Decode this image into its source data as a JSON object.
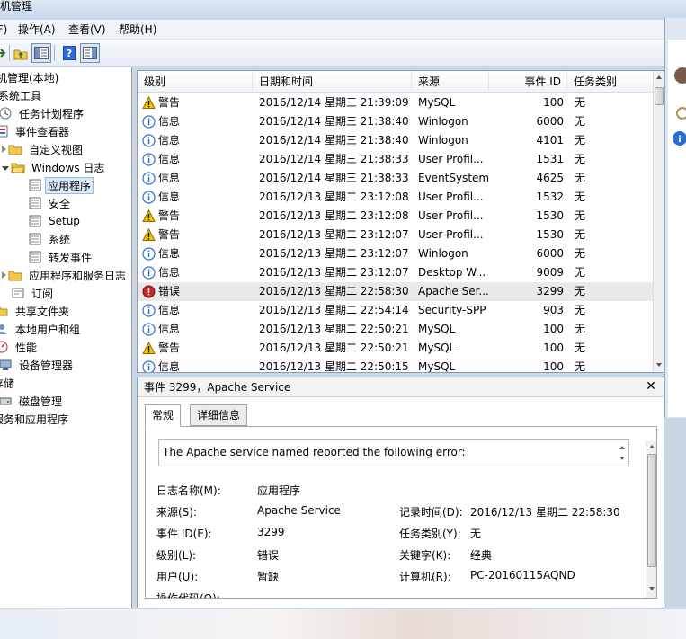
{
  "window": {
    "title": "机管理"
  },
  "menu": [
    {
      "label": "件(F)",
      "x": 0
    },
    {
      "label": "操作(A)"
    },
    {
      "label": "查看(V)"
    },
    {
      "label": "帮助(H)"
    }
  ],
  "tree": {
    "items": [
      {
        "label": "机管理(本地)"
      },
      {
        "label": "系统工具"
      },
      {
        "label": "任务计划程序"
      },
      {
        "label": "事件查看器"
      },
      {
        "label": "自定义视图"
      },
      {
        "label": "Windows 日志"
      },
      {
        "label": "应用程序"
      },
      {
        "label": "安全"
      },
      {
        "label": "Setup"
      },
      {
        "label": "系统"
      },
      {
        "label": "转发事件"
      },
      {
        "label": "应用程序和服务日志"
      },
      {
        "label": "订阅"
      },
      {
        "label": "共享文件夹"
      },
      {
        "label": "本地用户和组"
      },
      {
        "label": "性能"
      },
      {
        "label": "设备管理器"
      },
      {
        "label": "存储"
      },
      {
        "label": "磁盘管理"
      },
      {
        "label": "服务和应用程序"
      }
    ]
  },
  "grid": {
    "columns": [
      "级别",
      "日期和时间",
      "来源",
      "事件 ID",
      "任务类别"
    ],
    "rows": [
      {
        "level": "警告",
        "icon": "warning-icon",
        "datetime": "2016/12/14 星期三 21:39:09",
        "source": "MySQL",
        "id": "100",
        "task": "无"
      },
      {
        "level": "信息",
        "icon": "info-icon",
        "datetime": "2016/12/14 星期三 21:38:40",
        "source": "Winlogon",
        "id": "6000",
        "task": "无"
      },
      {
        "level": "信息",
        "icon": "info-icon",
        "datetime": "2016/12/14 星期三 21:38:40",
        "source": "Winlogon",
        "id": "4101",
        "task": "无"
      },
      {
        "level": "信息",
        "icon": "info-icon",
        "datetime": "2016/12/14 星期三 21:38:33",
        "source": "User Profil...",
        "id": "1531",
        "task": "无"
      },
      {
        "level": "信息",
        "icon": "info-icon",
        "datetime": "2016/12/14 星期三 21:38:33",
        "source": "EventSystem",
        "id": "4625",
        "task": "无"
      },
      {
        "level": "信息",
        "icon": "info-icon",
        "datetime": "2016/12/13 星期二 23:12:08",
        "source": "User Profil...",
        "id": "1532",
        "task": "无"
      },
      {
        "level": "警告",
        "icon": "warning-icon",
        "datetime": "2016/12/13 星期二 23:12:08",
        "source": "User Profil...",
        "id": "1530",
        "task": "无"
      },
      {
        "level": "警告",
        "icon": "warning-icon",
        "datetime": "2016/12/13 星期二 23:12:07",
        "source": "User Profil...",
        "id": "1530",
        "task": "无"
      },
      {
        "level": "信息",
        "icon": "info-icon",
        "datetime": "2016/12/13 星期二 23:12:07",
        "source": "Winlogon",
        "id": "6000",
        "task": "无"
      },
      {
        "level": "信息",
        "icon": "info-icon",
        "datetime": "2016/12/13 星期二 23:12:07",
        "source": "Desktop W...",
        "id": "9009",
        "task": "无"
      },
      {
        "level": "错误",
        "icon": "error-icon",
        "datetime": "2016/12/13 星期二 22:58:30",
        "source": "Apache Ser...",
        "id": "3299",
        "task": "无",
        "selected": true
      },
      {
        "level": "信息",
        "icon": "info-icon",
        "datetime": "2016/12/13 星期二 22:54:14",
        "source": "Security-SPP",
        "id": "903",
        "task": "无"
      },
      {
        "level": "信息",
        "icon": "info-icon",
        "datetime": "2016/12/13 星期二 22:50:21",
        "source": "MySQL",
        "id": "100",
        "task": "无"
      },
      {
        "level": "警告",
        "icon": "warning-icon",
        "datetime": "2016/12/13 星期二 22:50:21",
        "source": "MySQL",
        "id": "100",
        "task": "无"
      },
      {
        "level": "信息",
        "icon": "info-icon",
        "datetime": "2016/12/13 星期二 22:50:15",
        "source": "MySQL",
        "id": "100",
        "task": "无"
      }
    ]
  },
  "detail": {
    "title": "事件 3299，Apache Service",
    "tabs": [
      "常规",
      "详细信息"
    ],
    "message": "The Apache service named  reported the following error:",
    "fields": {
      "log_name_label": "日志名称(M):",
      "log_name": "应用程序",
      "source_label": "来源(S):",
      "source": "Apache Service",
      "logged_label": "记录时间(D):",
      "logged": "2016/12/13 星期二 22:58:30",
      "event_id_label": "事件 ID(E):",
      "event_id": "3299",
      "task_label": "任务类别(Y):",
      "task": "无",
      "level_label": "级别(L):",
      "level": "错误",
      "keywords_label": "关键字(K):",
      "keywords": "经典",
      "user_label": "用户(U):",
      "user": "暂缺",
      "computer_label": "计算机(R):",
      "computer": "PC-20160115AQND",
      "opcode_label": "操作代码(O):"
    }
  },
  "colors": {
    "warning": "#f5c400",
    "info": "#2a6fd0",
    "error": "#c0282f",
    "selection": "#e9e9e9"
  }
}
